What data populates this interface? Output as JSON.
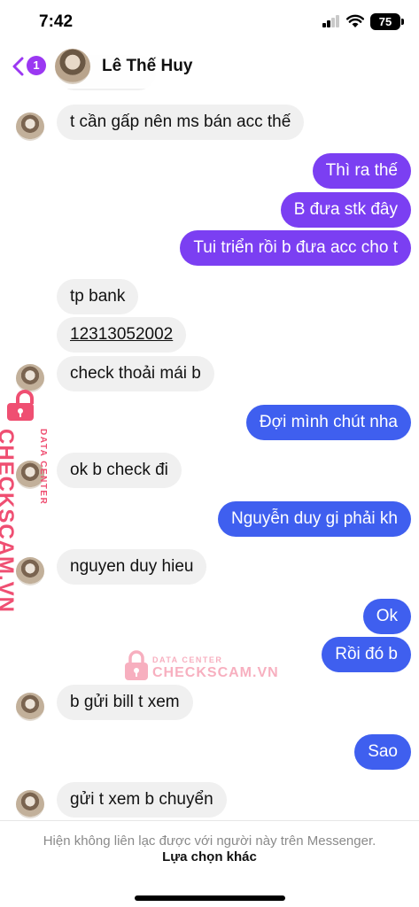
{
  "status_bar": {
    "time": "7:42",
    "battery": "75"
  },
  "header": {
    "unread_count": "1",
    "contact_name": "Lê Thế Huy"
  },
  "messages": [
    {
      "side": "in",
      "text": "t cần gấp nên ms bán acc thế"
    },
    {
      "side": "out",
      "text": "Thì ra thế"
    },
    {
      "side": "out",
      "text": "B đưa stk đây"
    },
    {
      "side": "out",
      "text": "Tui triển rồi b đưa acc cho t"
    },
    {
      "side": "in",
      "text": "tp bank"
    },
    {
      "side": "in",
      "text": "12313052002"
    },
    {
      "side": "in",
      "text": "check thoải mái b"
    },
    {
      "side": "out",
      "text": "Đợi mình chút nha"
    },
    {
      "side": "in",
      "text": "ok b check đi"
    },
    {
      "side": "out",
      "text": "Nguyễn duy gi phải kh"
    },
    {
      "side": "in",
      "text": "nguyen duy hieu"
    },
    {
      "side": "out",
      "text": "Ok"
    },
    {
      "side": "out",
      "text": "Rồi đó b"
    },
    {
      "side": "in",
      "text": "b gửi bill t xem"
    },
    {
      "side": "out",
      "text": "Sao"
    },
    {
      "side": "in",
      "text": "gửi t xem b chuyển"
    }
  ],
  "watermark": {
    "brand": "CHECKSCAM.VN",
    "sub": "DATA CENTER"
  },
  "footer": {
    "notice": "Hiện không liên lạc được với người này trên Messenger.",
    "action": "Lựa chọn khác"
  },
  "colors": {
    "purple": "#7b3ff2",
    "blue": "#3f5fef",
    "incoming": "#f0f0f0",
    "watermark": "#ef4f72"
  }
}
